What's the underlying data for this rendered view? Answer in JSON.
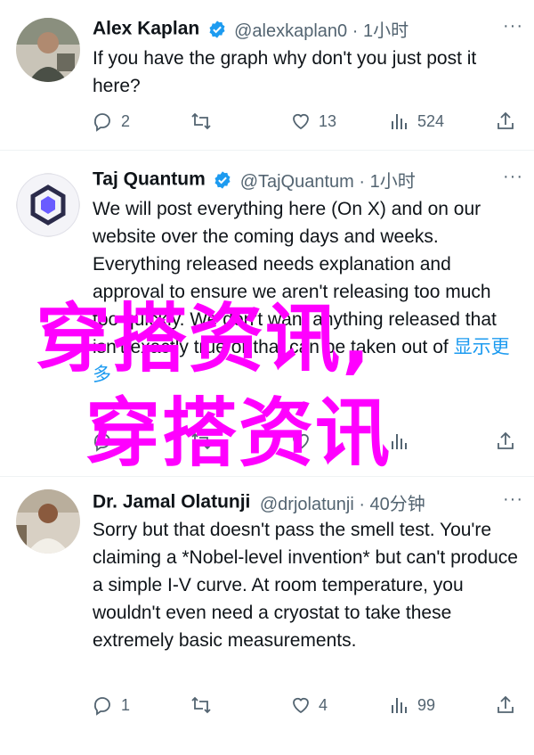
{
  "tweets": [
    {
      "name": "Alex Kaplan",
      "handle_time": "@alexkaplan0 · 1小时",
      "body": "If you have the graph why don't you just post it here?",
      "show_more": "",
      "counts": {
        "reply": "2",
        "retweet": "",
        "like": "13",
        "views": "524"
      }
    },
    {
      "name": "Taj Quantum",
      "handle_time": "@TajQuantum · 1小时",
      "body": "We will post everything here (On X) and on our website over the coming days and weeks. Everything released needs explanation and approval to ensure we aren't releasing too much too quickly. We don't want anything released that isn't exactly true or that can be taken out of",
      "show_more": "显示更多",
      "counts": {
        "reply": "",
        "retweet": "",
        "like": "",
        "views": ""
      }
    },
    {
      "name": "Dr. Jamal Olatunji",
      "handle_time": "@drjolatunji · 40分钟",
      "body": "Sorry but that doesn't pass the smell test. You're claiming a *Nobel-level invention* but can't produce a simple I-V curve. At room temperature, you wouldn't even need a cryostat to take these extremely basic measurements.",
      "show_more": "",
      "counts": {
        "reply": "1",
        "retweet": "",
        "like": "4",
        "views": "99"
      }
    }
  ],
  "watermark": {
    "line1": "穿搭资讯,",
    "line2": "穿搭资讯"
  },
  "colors": {
    "verified": "#1d9bf0",
    "muted": "#536471",
    "watermark": "#ff00ff",
    "link": "#1d9bf0"
  }
}
